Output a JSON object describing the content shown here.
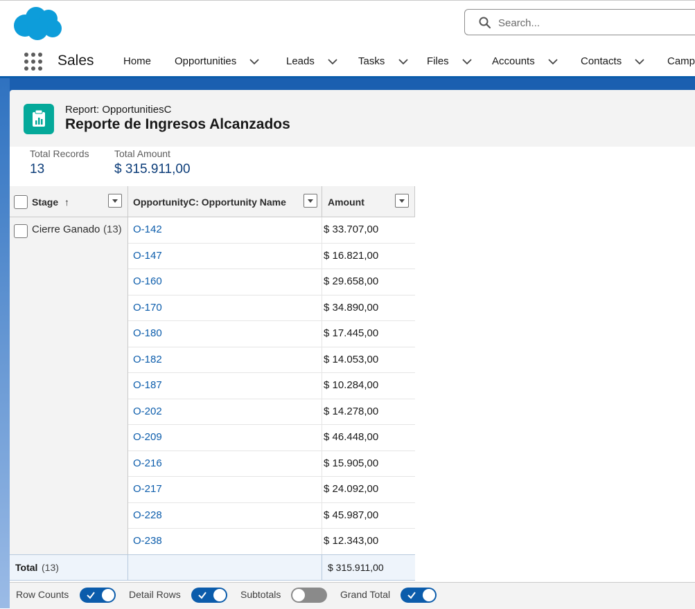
{
  "search": {
    "placeholder": "Search..."
  },
  "app": {
    "name": "Sales"
  },
  "nav": {
    "items": [
      {
        "label": "Home",
        "has_menu": false
      },
      {
        "label": "Opportunities",
        "has_menu": true
      },
      {
        "label": "Leads",
        "has_menu": true
      },
      {
        "label": "Tasks",
        "has_menu": true
      },
      {
        "label": "Files",
        "has_menu": true
      },
      {
        "label": "Accounts",
        "has_menu": true
      },
      {
        "label": "Contacts",
        "has_menu": true
      },
      {
        "label": "Camp",
        "has_menu": false
      }
    ]
  },
  "report": {
    "type_label": "Report: OpportunitiesC",
    "title": "Reporte de Ingresos Alcanzados"
  },
  "summary": {
    "records_label": "Total Records",
    "records_value": "13",
    "amount_label": "Total Amount",
    "amount_value": "$ 315.911,00"
  },
  "table": {
    "headers": {
      "stage": "Stage",
      "stage_sort": "↑",
      "name": "OpportunityC: Opportunity Name",
      "amount": "Amount"
    },
    "group": {
      "label": "Cierre Ganado",
      "count": "(13)"
    },
    "rows": [
      {
        "name": "O-142",
        "amount": "$ 33.707,00"
      },
      {
        "name": "O-147",
        "amount": "$ 16.821,00"
      },
      {
        "name": "O-160",
        "amount": "$ 29.658,00"
      },
      {
        "name": "O-170",
        "amount": "$ 34.890,00"
      },
      {
        "name": "O-180",
        "amount": "$ 17.445,00"
      },
      {
        "name": "O-182",
        "amount": "$ 14.053,00"
      },
      {
        "name": "O-187",
        "amount": "$ 10.284,00"
      },
      {
        "name": "O-202",
        "amount": "$ 14.278,00"
      },
      {
        "name": "O-209",
        "amount": "$ 46.448,00"
      },
      {
        "name": "O-216",
        "amount": "$ 15.905,00"
      },
      {
        "name": "O-217",
        "amount": "$ 24.092,00"
      },
      {
        "name": "O-228",
        "amount": "$ 45.987,00"
      },
      {
        "name": "O-238",
        "amount": "$ 12.343,00"
      }
    ],
    "total": {
      "label": "Total",
      "count": "(13)",
      "amount": "$ 315.911,00"
    }
  },
  "footer": {
    "toggles": [
      {
        "label": "Row Counts",
        "on": true
      },
      {
        "label": "Detail Rows",
        "on": true
      },
      {
        "label": "Subtotals",
        "on": false
      },
      {
        "label": "Grand Total",
        "on": true
      }
    ]
  },
  "colors": {
    "brand_blue": "#0b5cab",
    "report_icon": "#04a99a",
    "cloud_logo": "#0d9dda"
  }
}
